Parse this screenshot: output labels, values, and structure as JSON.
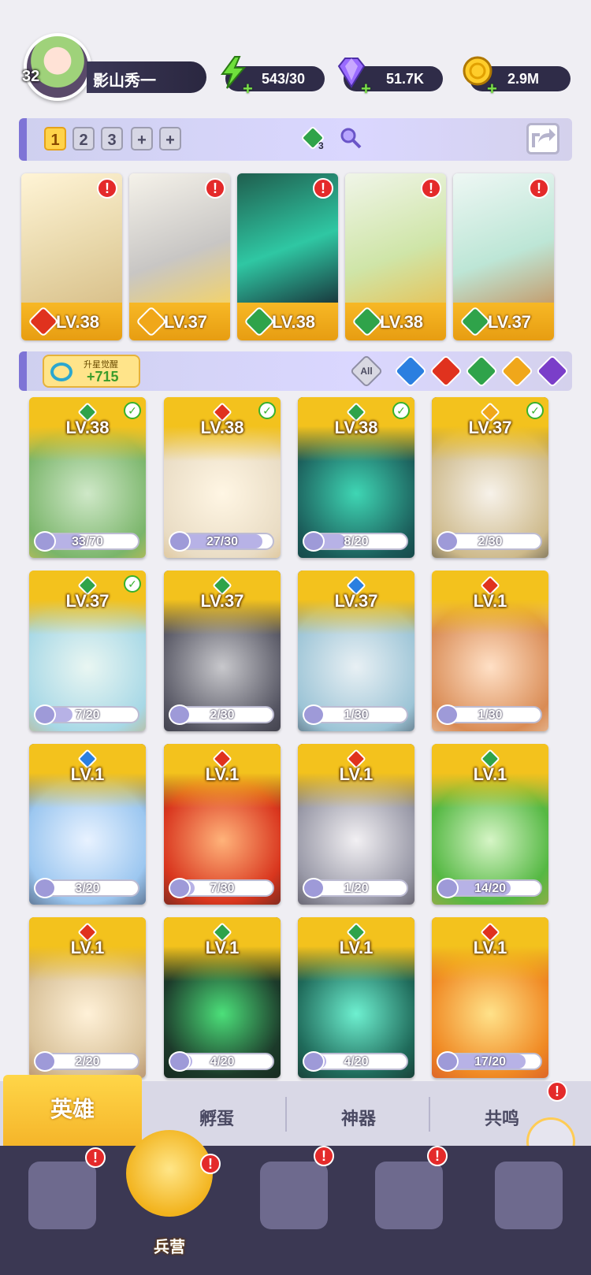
{
  "player": {
    "level": "32",
    "name": "影山秀一"
  },
  "resources": {
    "energy": "543/30",
    "gems": "51.7K",
    "gold": "2.9M"
  },
  "team_bar": {
    "slots": [
      "1",
      "2",
      "3",
      "+",
      "+"
    ],
    "active_slot": "1",
    "element_count": "3"
  },
  "featured_heroes": [
    {
      "level": "LV.38",
      "element": "fire",
      "alert": "!"
    },
    {
      "level": "LV.37",
      "element": "light",
      "alert": "!"
    },
    {
      "level": "LV.38",
      "element": "nature",
      "alert": "!"
    },
    {
      "level": "LV.38",
      "element": "nature",
      "alert": "!"
    },
    {
      "level": "LV.37",
      "element": "nature",
      "alert": "!"
    }
  ],
  "filter_bar": {
    "awaken_label": "升星觉醒",
    "awaken_value": "+715",
    "all_label": "All",
    "filters": [
      "water",
      "fire",
      "nature",
      "light",
      "dark"
    ]
  },
  "heroes": [
    {
      "level": "LV.38",
      "element": "nature",
      "progress": "33/70",
      "ratio": 0.47,
      "ready": true
    },
    {
      "level": "LV.38",
      "element": "fire",
      "progress": "27/30",
      "ratio": 0.9,
      "ready": true
    },
    {
      "level": "LV.38",
      "element": "nature",
      "progress": "8/20",
      "ratio": 0.4,
      "ready": true
    },
    {
      "level": "LV.37",
      "element": "light",
      "progress": "2/30",
      "ratio": 0.07,
      "ready": true
    },
    {
      "level": "LV.37",
      "element": "nature",
      "progress": "7/20",
      "ratio": 0.35,
      "ready": true
    },
    {
      "level": "LV.37",
      "element": "nature",
      "progress": "2/30",
      "ratio": 0.07,
      "ready": false
    },
    {
      "level": "LV.37",
      "element": "water",
      "progress": "1/30",
      "ratio": 0.03,
      "ready": false
    },
    {
      "level": "LV.1",
      "element": "fire",
      "progress": "1/30",
      "ratio": 0.03,
      "ready": false
    },
    {
      "level": "LV.1",
      "element": "water",
      "progress": "3/20",
      "ratio": 0.15,
      "ready": false
    },
    {
      "level": "LV.1",
      "element": "fire",
      "progress": "7/30",
      "ratio": 0.23,
      "ready": false
    },
    {
      "level": "LV.1",
      "element": "fire",
      "progress": "1/20",
      "ratio": 0.05,
      "ready": false
    },
    {
      "level": "LV.1",
      "element": "nature",
      "progress": "14/20",
      "ratio": 0.7,
      "ready": false
    },
    {
      "level": "LV.1",
      "element": "fire",
      "progress": "2/20",
      "ratio": 0.1,
      "ready": false
    },
    {
      "level": "LV.1",
      "element": "nature",
      "progress": "4/20",
      "ratio": 0.2,
      "ready": false
    },
    {
      "level": "LV.1",
      "element": "nature",
      "progress": "4/20",
      "ratio": 0.2,
      "ready": false
    },
    {
      "level": "LV.1",
      "element": "fire",
      "progress": "17/20",
      "ratio": 0.85,
      "ready": false
    }
  ],
  "subtabs": [
    {
      "label": "英雄",
      "active": true
    },
    {
      "label": "孵蛋",
      "active": false
    },
    {
      "label": "神器",
      "active": false
    },
    {
      "label": "共鸣",
      "active": false
    }
  ],
  "bottom_nav": [
    {
      "label": "",
      "alert": "!"
    },
    {
      "label": "兵营",
      "alert": "!",
      "active": true
    },
    {
      "label": "",
      "alert": "!"
    },
    {
      "label": "",
      "alert": "!"
    },
    {
      "label": "",
      "alert": ""
    }
  ],
  "colors": {
    "fire": "#e0321e",
    "water": "#2b7fe0",
    "nature": "#2fa34a",
    "light": "#f0a71a",
    "dark": "#7a3ec9",
    "card_gold": "#f3c21d"
  }
}
